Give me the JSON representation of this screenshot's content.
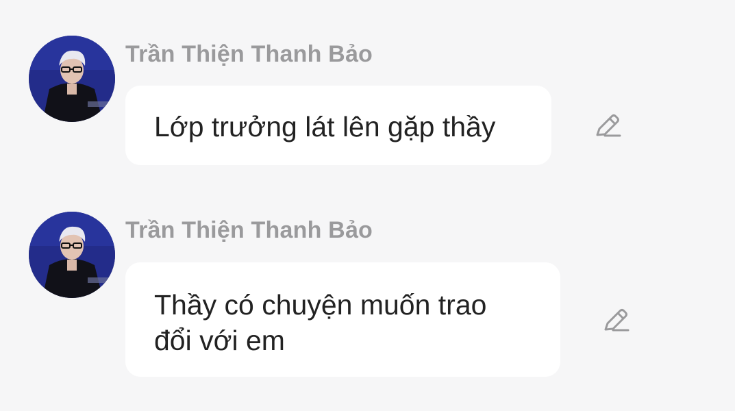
{
  "messages": [
    {
      "sender": "Trần Thiện Thanh Bảo",
      "text": "Lớp trưởng lát lên gặp thầy",
      "avatar": "user-avatar-photo",
      "action_icon": "edit-pencil-icon"
    },
    {
      "sender": "Trần Thiện Thanh Bảo",
      "text": "Thầy có chuyện muốn trao đổi với em",
      "avatar": "user-avatar-photo",
      "action_icon": "edit-pencil-icon"
    }
  ],
  "colors": {
    "background": "#f6f6f7",
    "bubble": "#ffffff",
    "sender_name": "#9a9a9c",
    "message_text": "#222222",
    "icon": "#9a9a9c"
  }
}
